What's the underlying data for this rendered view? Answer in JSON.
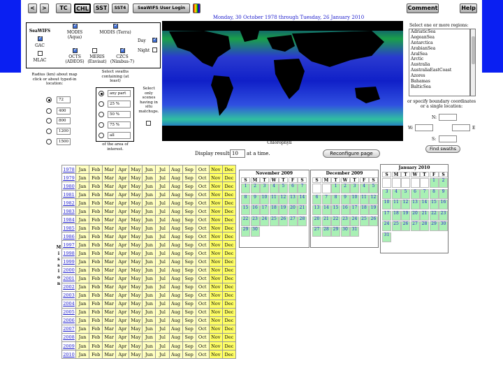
{
  "toolbar": {
    "back": "<",
    "forward": ">",
    "tc": "TC",
    "chl": "CHL",
    "sst": "SST",
    "sst4": "SST4",
    "user_login": "SeaWIFS User Login",
    "comment": "Comment",
    "help": "Help"
  },
  "date_range": "Monday, 30 October 1978 through Tuesday, 26 January 2010",
  "sensors": {
    "seawifs": "SeaWIFS",
    "gac": "GAC",
    "mlac": "MLAC",
    "modis_aqua": "MODIS (Aqua)",
    "modis_terra": "MODIS (Terra)",
    "octs": "OCTS (ADEOS)",
    "meris": "MERIS (Envisat)",
    "czcs": "CZCS (Nimbus-7)",
    "day": "Day",
    "night": "Night"
  },
  "radius": {
    "label": "Radius (km) about map click or about typed-in location:",
    "options": [
      "72",
      "400",
      "800",
      "1200",
      "1500"
    ]
  },
  "swaths": {
    "label": "Select swaths containing (at least)",
    "options": [
      "any part",
      "25 %",
      "50 %",
      "75 %",
      "all"
    ],
    "footer": "of the area of interest."
  },
  "only_label": "Select only scenes having in situ matchups.",
  "map_caption": "Chlorophyll",
  "results": {
    "pre": "Display results",
    "value": "10",
    "post": "at a time."
  },
  "reconfigure": "Reconfigure page",
  "regions": {
    "label": "Select one or more regions:",
    "items": [
      "AdriaticSea",
      "AegeanSea",
      "Antarctica",
      "ArabianSea",
      "AralSea",
      "Arctic",
      "Australia",
      "AustraliaEastCoast",
      "Azores",
      "Bahamas",
      "BalticSea"
    ]
  },
  "coords": {
    "text": "or specify boundary coordinates or a single location:",
    "n": "N:",
    "w": "W:",
    "e": "E",
    "s": "S:",
    "find": "Find swaths"
  },
  "mission_label": [
    "M",
    "i",
    "s",
    "s",
    "i",
    "o",
    "n"
  ],
  "years": [
    "1978",
    "1979",
    "1980",
    "1981",
    "1982",
    "1983",
    "1984",
    "1985",
    "1986",
    "1997",
    "1998",
    "1999",
    "2000",
    "2001",
    "2002",
    "2003",
    "2004",
    "2005",
    "2006",
    "2007",
    "2008",
    "2009",
    "2010"
  ],
  "months": [
    "Jan",
    "Feb",
    "Mar",
    "Apr",
    "May",
    "Jun",
    "Jul",
    "Aug",
    "Sep",
    "Oct",
    "Nov",
    "Dec"
  ],
  "calendars": [
    {
      "title": "November 2009",
      "dow": [
        "S",
        "M",
        "T",
        "W",
        "T",
        "F",
        "S"
      ],
      "start": 0,
      "days": [
        "1",
        "2",
        "3",
        "4",
        "5",
        "6",
        "7",
        "8",
        "9",
        "10",
        "11",
        "12",
        "13",
        "14",
        "15",
        "16",
        "17",
        "18",
        "19",
        "20",
        "21",
        "22",
        "23",
        "24",
        "25",
        "26",
        "27",
        "28",
        "29",
        "30"
      ]
    },
    {
      "title": "December 2009",
      "dow": [
        "S",
        "M",
        "T",
        "W",
        "T",
        "F",
        "S"
      ],
      "start": 2,
      "days": [
        "1",
        "2",
        "3",
        "4",
        "5",
        "6",
        "7",
        "8",
        "9",
        "10",
        "11",
        "12",
        "13",
        "14",
        "15",
        "16",
        "17",
        "18",
        "19",
        "20",
        "21",
        "22",
        "23",
        "24",
        "25",
        "26",
        "27",
        "28",
        "29",
        "30",
        "31"
      ]
    },
    {
      "title": "January 2010",
      "dow": [
        "S",
        "M",
        "T",
        "W",
        "T",
        "F",
        "S"
      ],
      "start": 5,
      "days": [
        "1",
        "2",
        "3",
        "4",
        "5",
        "6",
        "7",
        "8",
        "9",
        "10",
        "11",
        "12",
        "13",
        "14",
        "15",
        "16",
        "17",
        "18",
        "19",
        "20",
        "21",
        "22",
        "23",
        "24",
        "25",
        "26",
        "27",
        "28",
        "29",
        "30",
        "31"
      ]
    }
  ],
  "colors": {
    "band": "#0a1ff2",
    "link": "#1a1acc",
    "month_cell": "#ffffc0",
    "active_day": "#a9f0b4"
  }
}
